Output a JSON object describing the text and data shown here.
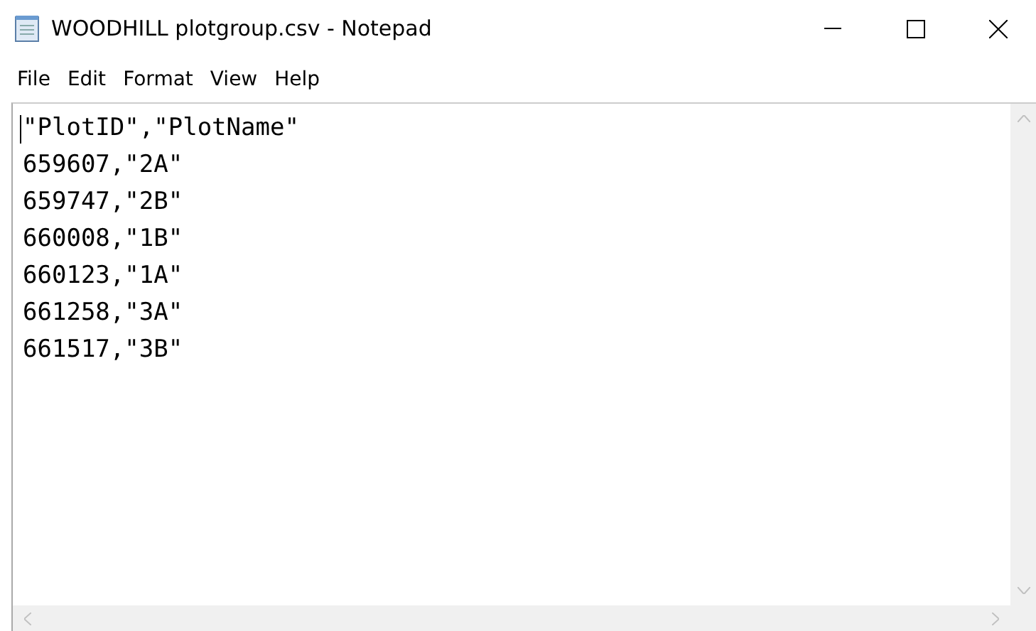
{
  "window": {
    "title": "WOODHILL plotgroup.csv - Notepad"
  },
  "menu": [
    "File",
    "Edit",
    "Format",
    "View",
    "Help"
  ],
  "editor": {
    "lines": [
      "\"PlotID\",\"PlotName\"",
      "659607,\"2A\"",
      "659747,\"2B\"",
      "660008,\"1B\"",
      "660123,\"1A\"",
      "661258,\"3A\"",
      "661517,\"3B\""
    ]
  }
}
